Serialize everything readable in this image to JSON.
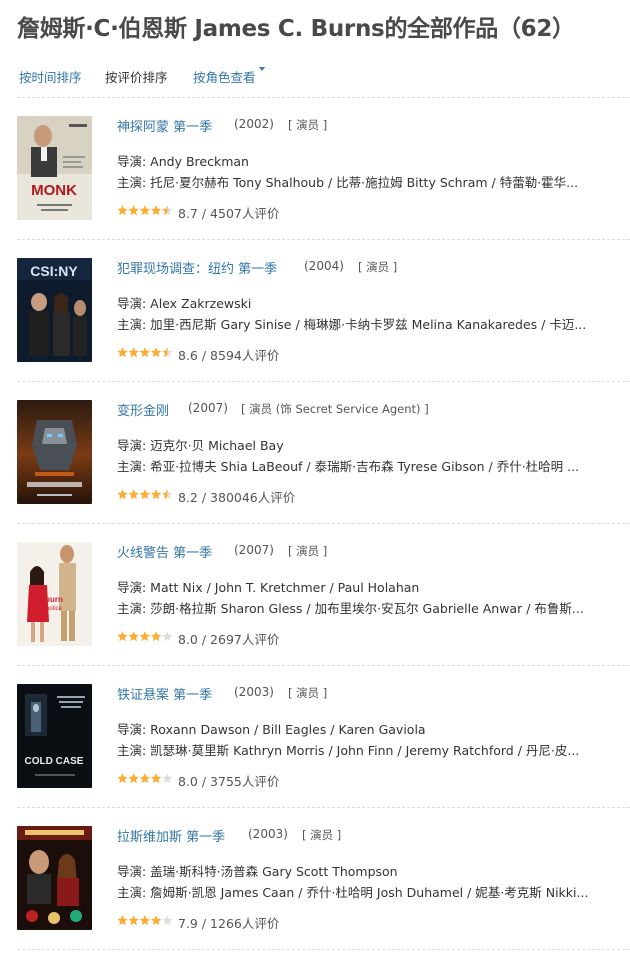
{
  "page": {
    "title": "詹姆斯·C·伯恩斯 James C. Burns的全部作品（62）"
  },
  "sort": {
    "by_time": "按时间排序",
    "by_rating": "按评价排序",
    "by_role": "按角色查看"
  },
  "colors": {
    "link": "#3377aa",
    "star": "#ffac2d",
    "star_empty": "#dddddd",
    "divider": "#dddddd"
  },
  "works": [
    {
      "title": "神探阿蒙 第一季",
      "year": "(2002)",
      "role": "[ 演员 ]",
      "director": "导演: Andy Breckman",
      "cast": "主演: 托尼·夏尔赫布 Tony Shalhoub / 比蒂·施拉姆 Bitty Schram / 特蕾勒·霍华...",
      "stars": 4.5,
      "score": "8.7 / 4507人评价",
      "poster_icon": "monk-poster"
    },
    {
      "title": "犯罪现场调查：纽约 第一季",
      "year": "(2004)",
      "role": "[ 演员 ]",
      "director": "导演: Alex Zakrzewski",
      "cast": "主演: 加里·西尼斯 Gary Sinise / 梅琳娜·卡纳卡罗兹 Melina Kanakaredes / 卡迈...",
      "stars": 4.5,
      "score": "8.6 / 8594人评价",
      "poster_icon": "csi-ny-poster"
    },
    {
      "title": "变形金刚",
      "year": "(2007)",
      "role": "[ 演员 (饰 Secret Service Agent) ]",
      "director": "导演: 迈克尔·贝 Michael Bay",
      "cast": "主演: 希亚·拉博夫 Shia LaBeouf / 泰瑞斯·吉布森 Tyrese Gibson / 乔什·杜哈明 ...",
      "stars": 4.5,
      "score": "8.2 / 380046人评价",
      "poster_icon": "transformers-poster"
    },
    {
      "title": "火线警告 第一季",
      "year": "(2007)",
      "role": "[ 演员 ]",
      "director": "导演: Matt Nix / John T. Kretchmer / Paul Holahan",
      "cast": "主演: 莎朗·格拉斯 Sharon Gless / 加布里埃尔·安瓦尔 Gabrielle Anwar / 布鲁斯...",
      "stars": 4,
      "score": "8.0 / 2697人评价",
      "poster_icon": "burn-notice-poster"
    },
    {
      "title": "铁证悬案 第一季",
      "year": "(2003)",
      "role": "[ 演员 ]",
      "director": "导演: Roxann Dawson / Bill Eagles / Karen Gaviola",
      "cast": "主演: 凯瑟琳·莫里斯 Kathryn Morris / John Finn / Jeremy Ratchford / 丹尼·皮...",
      "stars": 4,
      "score": "8.0 / 3755人评价",
      "poster_icon": "cold-case-poster"
    },
    {
      "title": "拉斯维加斯 第一季",
      "year": "(2003)",
      "role": "[ 演员 ]",
      "director": "导演: 盖瑞·斯科特·汤普森 Gary Scott Thompson",
      "cast": "主演: 詹姆斯·凯恩 James Caan / 乔什·杜哈明 Josh Duhamel / 妮基·考克斯 Nikki...",
      "stars": 4,
      "score": "7.9 / 1266人评价",
      "poster_icon": "las-vegas-poster"
    }
  ],
  "poster_text": {
    "monk": "MONK",
    "csi": "CSI:NY",
    "cold": "COLD CASE"
  }
}
